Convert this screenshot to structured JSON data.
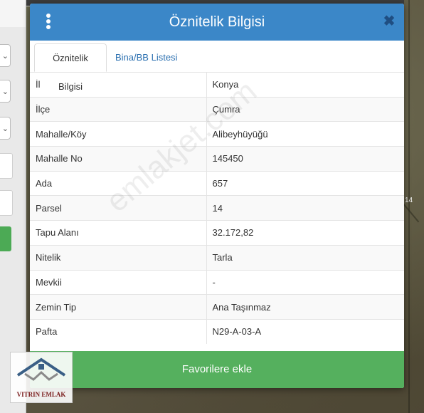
{
  "modal": {
    "title": "Öznitelik Bilgisi",
    "close_symbol": "✖",
    "tabs": [
      {
        "label": "Öznitelik Bilgisi",
        "active": true
      },
      {
        "label": "Bina/BB Listesi",
        "active": false
      }
    ],
    "rows": [
      {
        "key": "İl",
        "value": "Konya"
      },
      {
        "key": "İlçe",
        "value": "Çumra"
      },
      {
        "key": "Mahalle/Köy",
        "value": "Alibeyhüyüğü"
      },
      {
        "key": "Mahalle No",
        "value": "145450"
      },
      {
        "key": "Ada",
        "value": "657"
      },
      {
        "key": "Parsel",
        "value": "14"
      },
      {
        "key": "Tapu Alanı",
        "value": "32.172,82"
      },
      {
        "key": "Nitelik",
        "value": "Tarla"
      },
      {
        "key": "Mevkii",
        "value": "-"
      },
      {
        "key": "Zemin Tip",
        "value": "Ana Taşınmaz"
      },
      {
        "key": "Pafta",
        "value": "N29-A-03-A"
      }
    ],
    "favorite_button_label": "Favorilere ekle"
  },
  "map": {
    "parcel_label": "14"
  },
  "watermark_text": "emlakjet.com",
  "logo": {
    "text": "VITRIN EMLAK"
  },
  "colors": {
    "header": "#3b87c8",
    "favorite_button": "#55b05e",
    "tab_link": "#2a6fb0",
    "logo_text": "#7a1b1b"
  },
  "icons": {
    "menu": "menu-kebab-icon",
    "close": "close-icon",
    "logo": "house-roof-icon",
    "dropdown": "chevron-down-icon"
  }
}
